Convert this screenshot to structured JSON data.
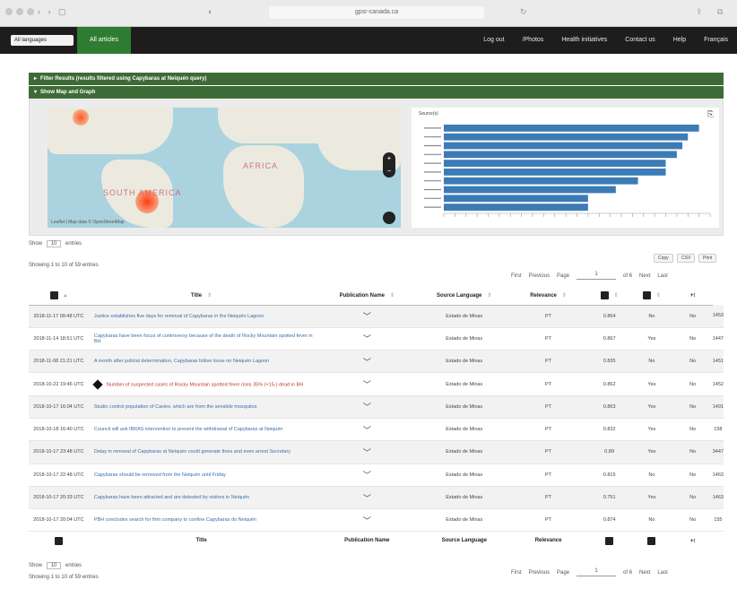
{
  "browser": {
    "url": "gpsr-canada.ca"
  },
  "nav": {
    "language": "All languages",
    "all_articles": "All articles",
    "links": [
      "Log out",
      "/Photos",
      "Health initiatives",
      "Contact us",
      "Help",
      "Français"
    ]
  },
  "filter_bar": {
    "label": "Filter Results (results filtered using Capybaras at Neiquén query)"
  },
  "map_bar": {
    "label": "Show Map and Graph"
  },
  "map": {
    "labels": {
      "south_america": "SOUTH AMERICA",
      "africa": "AFRICA"
    },
    "footer": "Leaflet | Map data © OpenStreetMap",
    "zoom_in": "+",
    "zoom_out": "−"
  },
  "bar_chart": {
    "legend": "Source(s)",
    "download_icon": "download-icon",
    "bars": [
      {
        "category": "",
        "value": 23
      },
      {
        "category": "",
        "value": 22
      },
      {
        "category": "",
        "value": 21.5
      },
      {
        "category": "",
        "value": 21
      },
      {
        "category": "",
        "value": 20
      },
      {
        "category": "",
        "value": 20
      },
      {
        "category": "",
        "value": 17.5
      },
      {
        "category": "",
        "value": 15.5
      },
      {
        "category": "",
        "value": 13
      },
      {
        "category": "",
        "value": 13
      }
    ],
    "xlim": [
      0,
      24
    ]
  },
  "table_controls": {
    "show": "Show",
    "entries_value": "10",
    "entries": "entries",
    "showing": "Showing 1 to 10 of 59 entries",
    "buttons": [
      "Copy",
      "CSV",
      "Print"
    ],
    "first": "First",
    "previous": "Previous",
    "page": "Page",
    "page_value": "1",
    "of": "of 6",
    "next": "Next",
    "last": "Last"
  },
  "table": {
    "headers": {
      "title": "Title",
      "publication": "Publication Name",
      "language": "Source Language",
      "relevance": "Relevance"
    },
    "rows": [
      {
        "date": "2018-11-17 09:48 UTC",
        "title": "Justice establishes five days for removal of Capybaras in the Neiquén Lagoon",
        "publication": "Estado de Minas",
        "language": "PT",
        "relevance": "0.864",
        "c1": "No",
        "c2": "No",
        "c3": "1453",
        "red": false
      },
      {
        "date": "2018-11-14 18:51 UTC",
        "title": "Capybaras have been focus of controversy because of the death of Rocky Mountain spotted fever in BH",
        "publication": "Estado de Minas",
        "language": "PT",
        "relevance": "0.867",
        "c1": "Yes",
        "c2": "No",
        "c3": "1447",
        "red": false
      },
      {
        "date": "2018-11-08 21:21 UTC",
        "title": "A month after judicial determination, Capybaras follow loose on Neiquén Lagoon",
        "publication": "Estado de Minas",
        "language": "PT",
        "relevance": "0.835",
        "c1": "No",
        "c2": "No",
        "c3": "1451",
        "red": false
      },
      {
        "date": "2018-10-22 19:46 UTC",
        "title": "Number of suspected cases of Rocky Mountain spotted fever rises 35% (+15-) dead in BH",
        "publication": "Estado de Minas",
        "language": "PT",
        "relevance": "0.862",
        "c1": "Yes",
        "c2": "No",
        "c3": "1452",
        "red": true
      },
      {
        "date": "2018-10-17 16:04 UTC",
        "title": "Studio control population of Cavies, which are from the sensible mosquitos",
        "publication": "Estado de Minas",
        "language": "PT",
        "relevance": "0.863",
        "c1": "Yes",
        "c2": "No",
        "c3": "1491",
        "red": false
      },
      {
        "date": "2018-10-18 16:40 UTC",
        "title": "Council will ask IBRAS intervention to prevent the withdrawal of Capybaras at Neiquén",
        "publication": "Estado de Minas",
        "language": "PT",
        "relevance": "0.832",
        "c1": "Yes",
        "c2": "No",
        "c3": "158",
        "red": false
      },
      {
        "date": "2018-10-17 23:48 UTC",
        "title": "Delay in removal of Capybaras at Neiquén could generate fines and even arrest Secretary",
        "publication": "Estado de Minas",
        "language": "PT",
        "relevance": "0.89",
        "c1": "Yes",
        "c2": "No",
        "c3": "3447",
        "red": false
      },
      {
        "date": "2018-10-17 22:48 UTC",
        "title": "Capybaras should be removed from the Neiquén until Friday",
        "publication": "Estado de Minas",
        "language": "PT",
        "relevance": "0.815",
        "c1": "No",
        "c2": "No",
        "c3": "1463",
        "red": false
      },
      {
        "date": "2018-10-17 20:33 UTC",
        "title": "Capybaras have been attracted and are detested by visitors in Neiquén",
        "publication": "Estado de Minas",
        "language": "PT",
        "relevance": "0.751",
        "c1": "Yes",
        "c2": "No",
        "c3": "1463",
        "red": false
      },
      {
        "date": "2018-10-17 20:04 UTC",
        "title": "PBH concludes search for firm company to confine Capybaras do Neiquén",
        "publication": "Estado de Minas",
        "language": "PT",
        "relevance": "0.874",
        "c1": "No",
        "c2": "No",
        "c3": "155",
        "red": false
      }
    ]
  },
  "colors": {
    "nav_bg": "#1d1d1d",
    "accent_green": "#2e7d32",
    "header_green": "#3d6b35",
    "bar": "#3d7bb5",
    "link": "#3a6ea8"
  }
}
